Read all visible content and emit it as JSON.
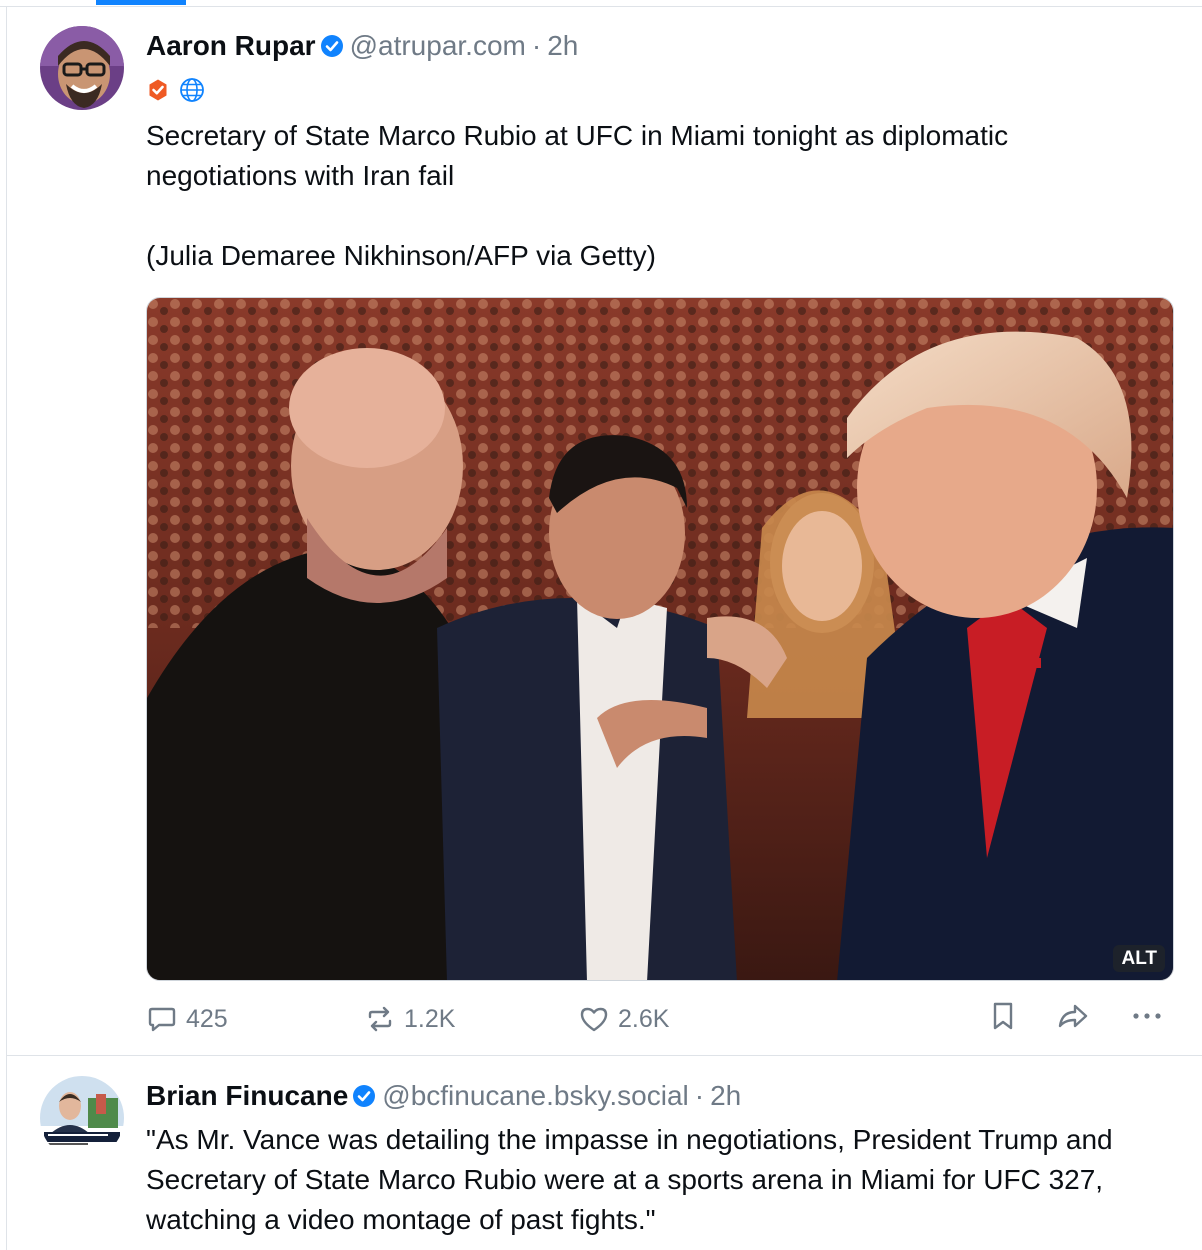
{
  "posts": [
    {
      "author": {
        "display_name": "Aaron Rupar",
        "handle": "@atrupar.com",
        "time": "2h",
        "verified_icon": "verified-badge-icon",
        "profile_badges": [
          "checkmark-badge-icon",
          "globe-icon"
        ]
      },
      "text": "Secretary of State Marco Rubio at UFC in Miami tonight as diplomatic negotiations with Iran fail\n\n(Julia Demaree Nikhinson/AFP via Getty)",
      "image": {
        "alt_label": "ALT"
      },
      "actions": {
        "replies": "425",
        "reposts": "1.2K",
        "likes": "2.6K",
        "bookmark_icon": "bookmark-icon",
        "share_icon": "share-icon",
        "more_icon": "more-icon"
      }
    },
    {
      "author": {
        "display_name": "Brian Finucane",
        "handle": "@bcfinucane.bsky.social",
        "time": "2h",
        "verified_icon": "verified-badge-icon"
      },
      "text": "\"As Mr. Vance was detailing the impasse in negotiations, President Trump and Secretary of State Marco Rubio were at a sports arena in Miami for UFC 327, watching a video montage of past fights.\""
    }
  ],
  "separator": "·",
  "colors": {
    "accent": "#1083fe",
    "muted_text": "#6f7a86",
    "divider": "#dfe3e8",
    "badge_orange": "#ef5a24"
  }
}
